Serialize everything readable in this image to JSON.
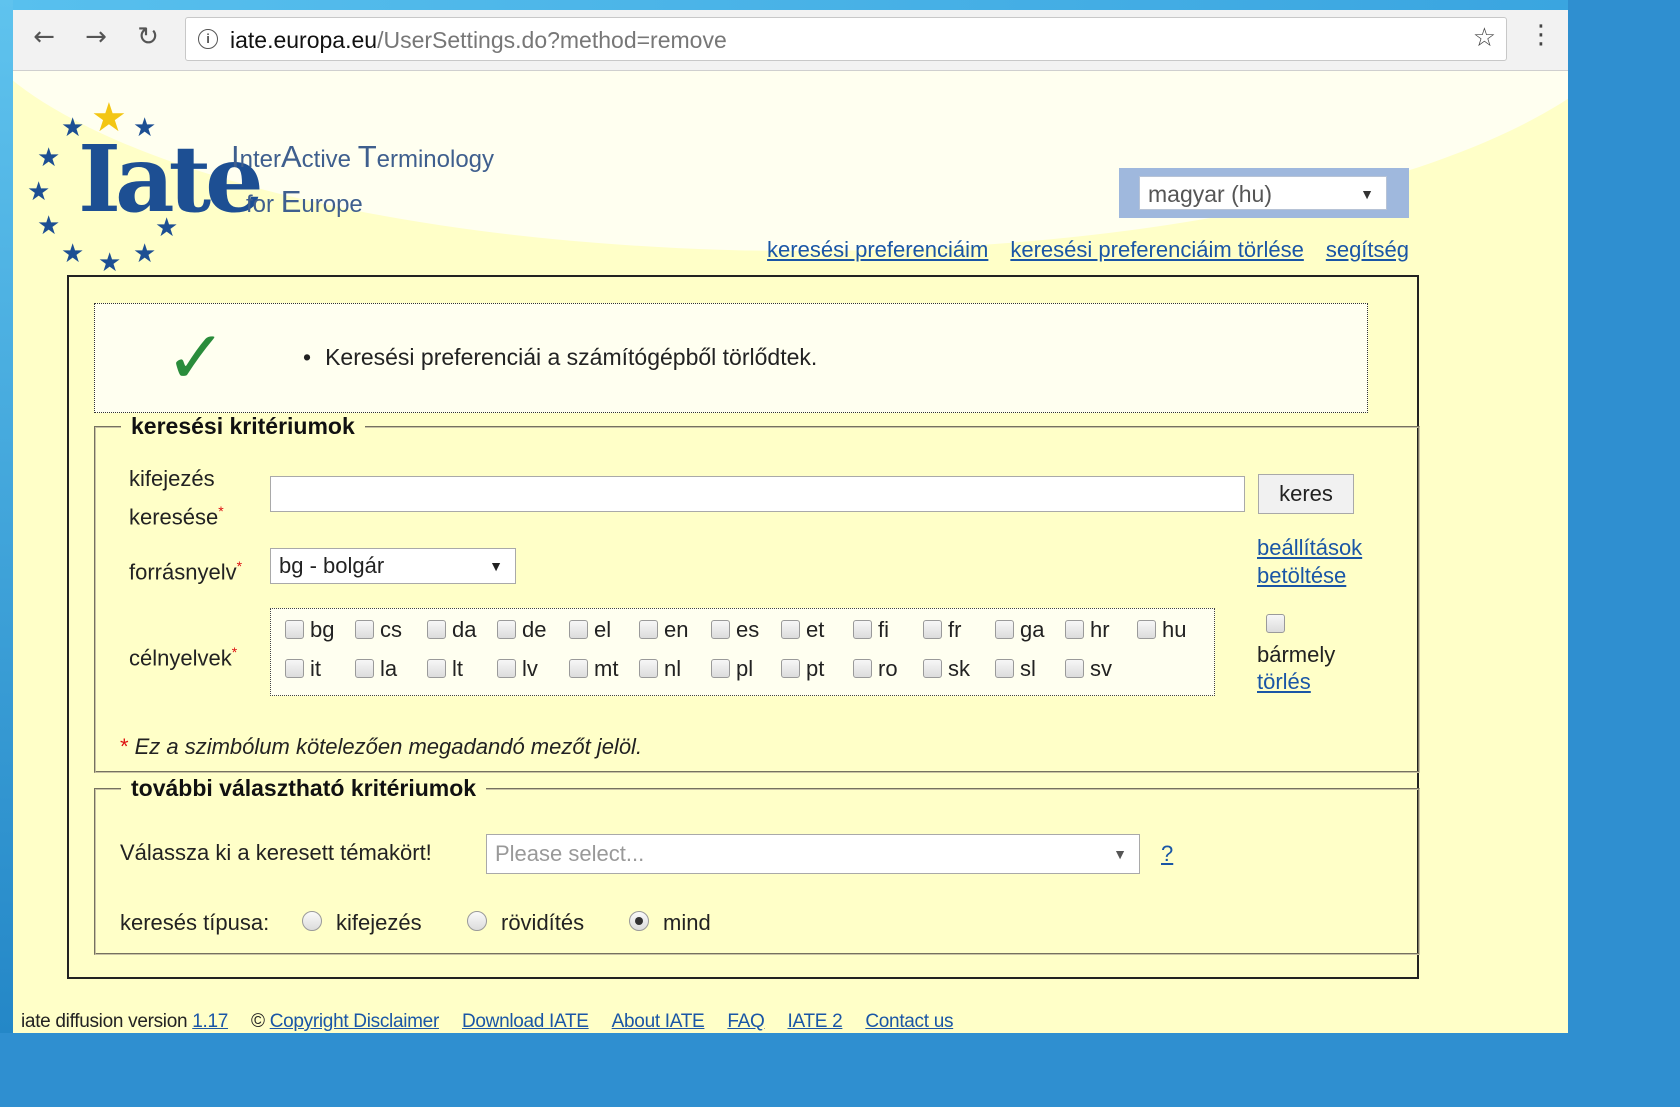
{
  "browser": {
    "url_host": "iate.europa.eu",
    "url_path": "/UserSettings.do?method=remove"
  },
  "header": {
    "logo_text": "Iate",
    "tagline_1": {
      "I": "I",
      "nter": "nter",
      "A": "A",
      "ctive": "ctive ",
      "T": "T",
      "erminology": "erminology"
    },
    "tagline_2": {
      "for": "for ",
      "E": "E",
      "urope": "urope"
    },
    "language_select": "magyar (hu)",
    "links": [
      "keresési preferenciáim",
      "keresési preferenciáim törlése",
      "segítség"
    ]
  },
  "message": "Keresési preferenciái a számítógépből törlődtek.",
  "criteria": {
    "legend": "keresési kritériumok",
    "term_label_1": "kifejezés",
    "term_label_2": "keresése",
    "term_value": "",
    "search_button": "keres",
    "source_label": "forrásnyelv",
    "source_value": "bg - bolgár",
    "load_settings_1": "beállítások",
    "load_settings_2": "betöltése",
    "target_label": "célnyelvek",
    "languages_row1": [
      "bg",
      "cs",
      "da",
      "de",
      "el",
      "en",
      "es",
      "et",
      "fi",
      "fr",
      "ga",
      "hr",
      "hu"
    ],
    "languages_row2": [
      "it",
      "la",
      "lt",
      "lv",
      "mt",
      "nl",
      "pl",
      "pt",
      "ro",
      "sk",
      "sl",
      "sv"
    ],
    "any_label": "bármely",
    "clear_link": "törlés",
    "required_star": "*",
    "required_note": "Ez a szimbólum kötelezően megadandó mezőt jelöl."
  },
  "optional": {
    "legend": "további választható kritériumok",
    "domain_label": "Válassza ki a keresett témakört!",
    "domain_placeholder": "Please select...",
    "help_link": "?",
    "type_label": "keresés típusa:",
    "types": [
      "kifejezés",
      "rövidítés",
      "mind"
    ],
    "selected_type": "mind"
  },
  "footer": {
    "version_label": "iate diffusion version",
    "version": "1.17",
    "copyright": "Copyright Disclaimer",
    "links": [
      "Download IATE",
      "About IATE",
      "FAQ",
      "IATE 2",
      "Contact us"
    ]
  }
}
